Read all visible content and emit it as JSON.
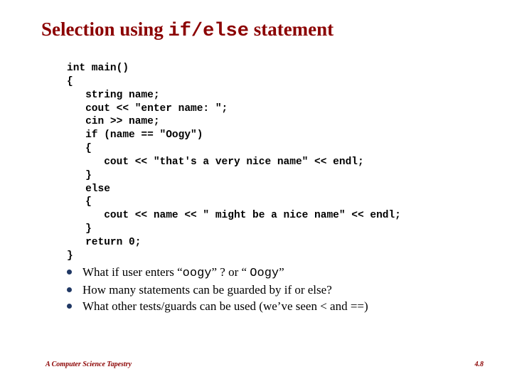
{
  "title_pre": "Selection using ",
  "title_mono": "if/else",
  "title_post": " statement",
  "code": "int main()\n{\n   string name;\n   cout << \"enter name: \";\n   cin >> name;\n   if (name == \"Oogy\")\n   {\n      cout << \"that's a very nice name\" << endl;\n   }\n   else\n   {\n      cout << name << \" might be a nice name\" << endl;\n   }\n   return 0;\n}",
  "bullets": [
    {
      "pre": "What if user enters “",
      "mono1": "oogy",
      "mid": "” ? or “ ",
      "mono2": "Oogy",
      "post": "”"
    },
    {
      "pre": "How many statements can be guarded by if or else?",
      "mono1": "",
      "mid": "",
      "mono2": "",
      "post": ""
    },
    {
      "pre": "What other tests/guards can be used (we’ve seen < and ==)",
      "mono1": "",
      "mid": "",
      "mono2": "",
      "post": ""
    }
  ],
  "footer_left": "A Computer Science Tapestry",
  "footer_right": "4.8"
}
